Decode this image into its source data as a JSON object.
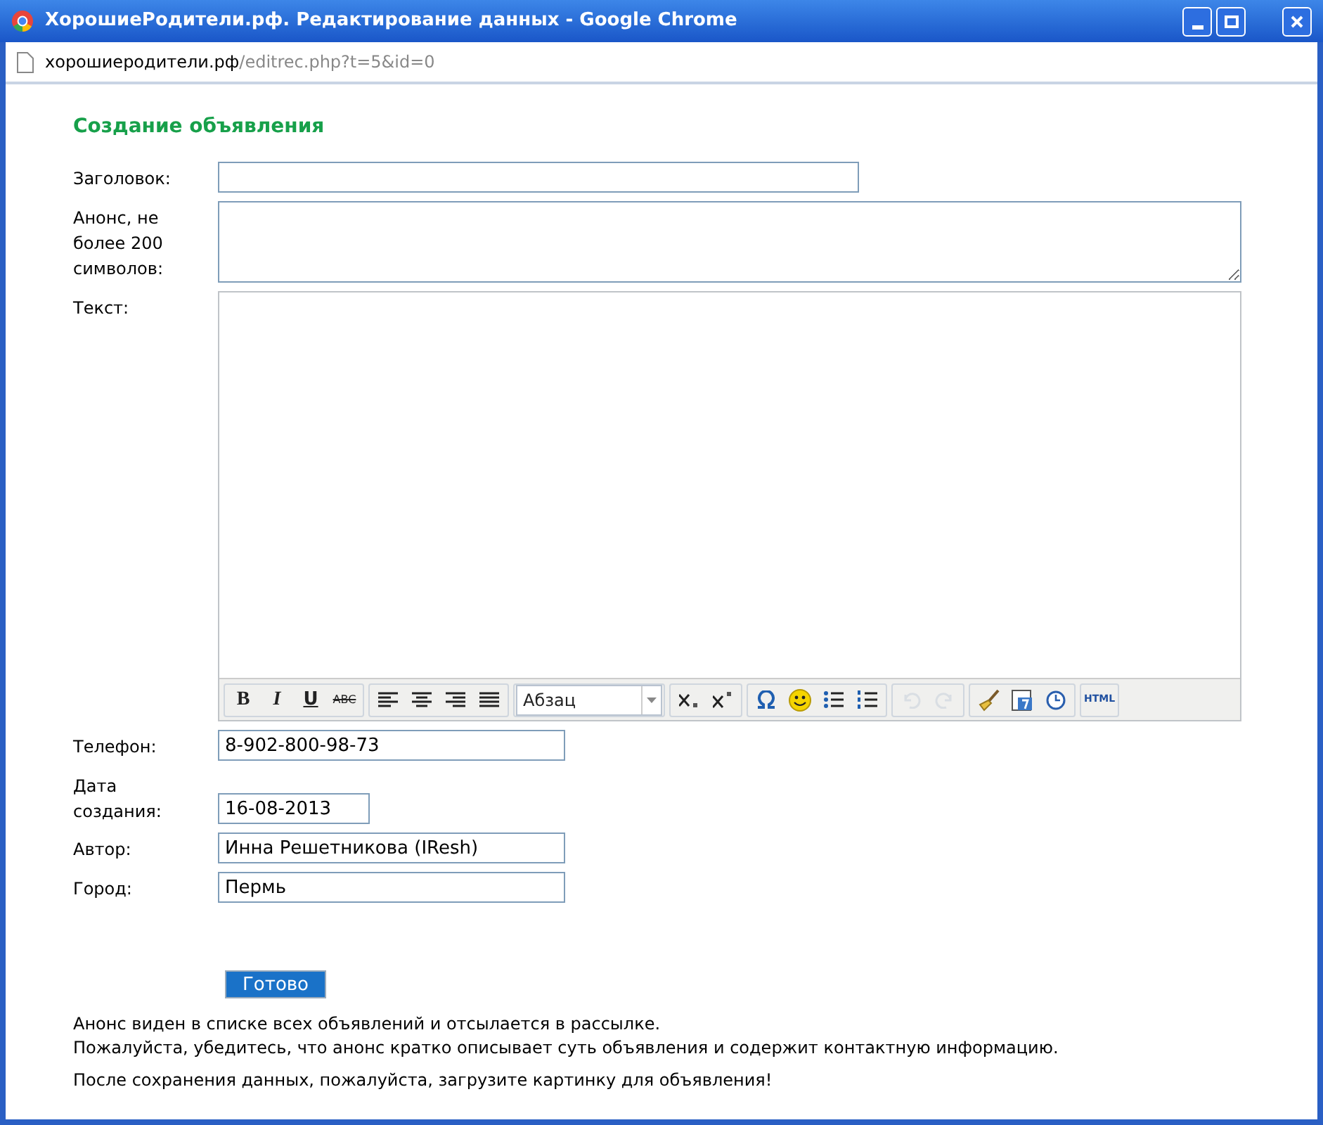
{
  "window": {
    "title": "ХорошиеРодители.рф. Редактирование данных - Google Chrome"
  },
  "address": {
    "host": "хорошиеродители.рф",
    "path": "/editrec.php?t=5&id=0"
  },
  "form": {
    "heading": "Создание объявления",
    "fields": [
      {
        "kind": "input",
        "label": "Заголовок:"
      },
      {
        "kind": "textarea",
        "label": "Анонс, не более 200 символов:"
      },
      {
        "kind": "editor",
        "label": "Текст:"
      }
    ],
    "toolbar": {
      "groups": [
        [
          {
            "kind": "bold",
            "label": "B",
            "disabled": false
          },
          {
            "kind": "italic",
            "label": "I",
            "disabled": false
          },
          {
            "kind": "underline",
            "label": "U",
            "disabled": false
          },
          {
            "kind": "strike",
            "label": "ABC",
            "disabled": false
          }
        ],
        [
          {
            "kind": "align-left",
            "disabled": false
          },
          {
            "kind": "align-center",
            "disabled": false
          },
          {
            "kind": "align-right",
            "disabled": false
          },
          {
            "kind": "justify",
            "disabled": false
          }
        ],
        [
          {
            "kind": "select",
            "label": "Абзац",
            "disabled": false
          }
        ],
        [
          {
            "kind": "subscript",
            "disabled": false
          },
          {
            "kind": "superscript",
            "disabled": false
          }
        ],
        [
          {
            "kind": "omega",
            "disabled": false
          },
          {
            "kind": "smiley",
            "disabled": false
          },
          {
            "kind": "bullets",
            "disabled": false
          },
          {
            "kind": "numbers",
            "disabled": false
          }
        ],
        [
          {
            "kind": "undo",
            "disabled": true
          },
          {
            "kind": "redo",
            "disabled": true
          }
        ],
        [
          {
            "kind": "brush",
            "disabled": false
          },
          {
            "kind": "date",
            "disabled": false
          },
          {
            "kind": "clock",
            "disabled": false
          }
        ],
        [
          {
            "kind": "html",
            "label": "HTML",
            "disabled": false
          }
        ]
      ]
    },
    "extra_fields": [
      {
        "kind": "text",
        "label": "Телефон:",
        "value": "8-902-800-98-73"
      },
      {
        "kind": "date",
        "label": "Дата создания:",
        "value": "16-08-2013"
      },
      {
        "kind": "text",
        "label": "Автор:",
        "value": "Инна Решетникова (IResh)"
      },
      {
        "kind": "text",
        "label": "Город:",
        "value": "Пермь"
      }
    ],
    "submit": "Готово",
    "notes": [
      "Анонс виден в списке всех объявлений и отсылается в рассылке.",
      "Пожалуйста, убедитесь, что анонс кратко описывает суть объявления и содержит контактную информацию."
    ],
    "footer_note": "После сохранения данных, пожалуйста, загрузите картинку для объявления!"
  }
}
